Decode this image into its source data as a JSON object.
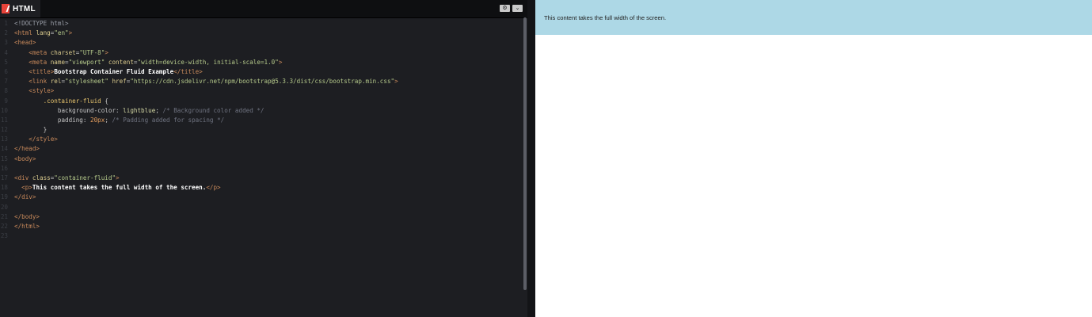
{
  "editor": {
    "language_label": "HTML",
    "settings_icon": "gear-icon",
    "collapse_icon": "chevron-down-icon",
    "lines": [
      {
        "n": "1",
        "segs": [
          [
            "t-doc",
            "<!DOCTYPE html>"
          ]
        ]
      },
      {
        "n": "2",
        "segs": [
          [
            "t-tag",
            "<html "
          ],
          [
            "t-attr",
            "lang"
          ],
          [
            "t-punc",
            "="
          ],
          [
            "t-val",
            "\"en\""
          ],
          [
            "t-tag",
            ">"
          ]
        ]
      },
      {
        "n": "3",
        "segs": [
          [
            "t-tag",
            "<head>"
          ]
        ]
      },
      {
        "n": "4",
        "segs": [
          [
            "t-punc",
            "    "
          ],
          [
            "t-tag",
            "<meta "
          ],
          [
            "t-attr",
            "charset"
          ],
          [
            "t-punc",
            "="
          ],
          [
            "t-val",
            "\"UTF-8\""
          ],
          [
            "t-tag",
            ">"
          ]
        ]
      },
      {
        "n": "5",
        "segs": [
          [
            "t-punc",
            "    "
          ],
          [
            "t-tag",
            "<meta "
          ],
          [
            "t-attr",
            "name"
          ],
          [
            "t-punc",
            "="
          ],
          [
            "t-val",
            "\"viewport\" "
          ],
          [
            "t-attr",
            "content"
          ],
          [
            "t-punc",
            "="
          ],
          [
            "t-val",
            "\"width=device-width, initial-scale=1.0\""
          ],
          [
            "t-tag",
            ">"
          ]
        ]
      },
      {
        "n": "6",
        "segs": [
          [
            "t-punc",
            "    "
          ],
          [
            "t-tag",
            "<title>"
          ],
          [
            "t-txt",
            "Bootstrap Container Fluid Example"
          ],
          [
            "t-tag",
            "</title>"
          ]
        ]
      },
      {
        "n": "7",
        "segs": [
          [
            "t-punc",
            "    "
          ],
          [
            "t-tag",
            "<link "
          ],
          [
            "t-attr",
            "rel"
          ],
          [
            "t-punc",
            "="
          ],
          [
            "t-val",
            "\"stylesheet\" "
          ],
          [
            "t-attr",
            "href"
          ],
          [
            "t-punc",
            "="
          ],
          [
            "t-val",
            "\"https://cdn.jsdelivr.net/npm/bootstrap@5.3.3/dist/css/bootstrap.min.css\""
          ],
          [
            "t-tag",
            ">"
          ]
        ]
      },
      {
        "n": "8",
        "segs": [
          [
            "t-punc",
            "    "
          ],
          [
            "t-tag",
            "<style>"
          ]
        ]
      },
      {
        "n": "9",
        "segs": [
          [
            "t-punc",
            "        "
          ],
          [
            "t-sel",
            ".container-fluid "
          ],
          [
            "t-punc",
            "{"
          ]
        ]
      },
      {
        "n": "10",
        "segs": [
          [
            "t-punc",
            "            "
          ],
          [
            "t-prop",
            "background-color: "
          ],
          [
            "t-kw",
            "lightblue"
          ],
          [
            "t-punc",
            "; "
          ],
          [
            "t-com",
            "/* Background color added */"
          ]
        ]
      },
      {
        "n": "11",
        "segs": [
          [
            "t-punc",
            "            "
          ],
          [
            "t-prop",
            "padding: "
          ],
          [
            "t-num",
            "20px"
          ],
          [
            "t-punc",
            "; "
          ],
          [
            "t-com",
            "/* Padding added for spacing */"
          ]
        ]
      },
      {
        "n": "12",
        "segs": [
          [
            "t-punc",
            "        }"
          ]
        ]
      },
      {
        "n": "13",
        "segs": [
          [
            "t-punc",
            "    "
          ],
          [
            "t-tag",
            "</style>"
          ]
        ]
      },
      {
        "n": "14",
        "segs": [
          [
            "t-tag",
            "</head>"
          ]
        ]
      },
      {
        "n": "15",
        "segs": [
          [
            "t-tag",
            "<body>"
          ]
        ]
      },
      {
        "n": "16",
        "segs": []
      },
      {
        "n": "17",
        "segs": [
          [
            "t-tag",
            "<div "
          ],
          [
            "t-attr",
            "class"
          ],
          [
            "t-punc",
            "="
          ],
          [
            "t-val",
            "\"container-fluid\""
          ],
          [
            "t-tag",
            ">"
          ]
        ]
      },
      {
        "n": "18",
        "segs": [
          [
            "t-punc",
            "  "
          ],
          [
            "t-tag",
            "<p>"
          ],
          [
            "t-txt",
            "This content takes the full width of the screen."
          ],
          [
            "t-tag",
            "</p>"
          ]
        ]
      },
      {
        "n": "19",
        "segs": [
          [
            "t-tag",
            "</div>"
          ]
        ]
      },
      {
        "n": "20",
        "segs": []
      },
      {
        "n": "21",
        "segs": [
          [
            "t-tag",
            "</body>"
          ]
        ]
      },
      {
        "n": "22",
        "segs": [
          [
            "t-tag",
            "</html>"
          ]
        ]
      },
      {
        "n": "23",
        "segs": []
      }
    ]
  },
  "preview": {
    "text": "This content takes the full width of the screen.",
    "bg_color": "#add8e6"
  }
}
